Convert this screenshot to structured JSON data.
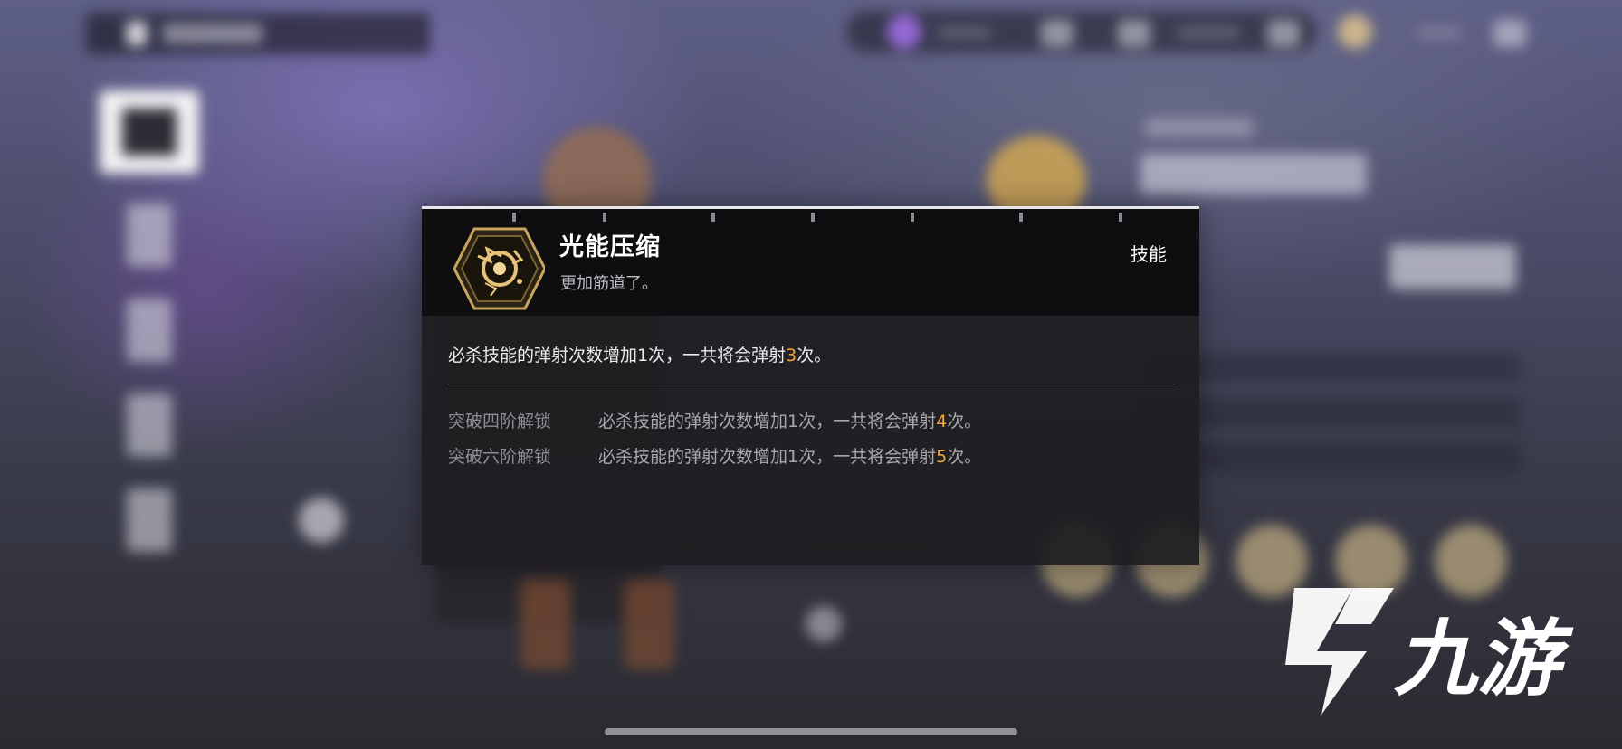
{
  "skill": {
    "name": "光能压缩",
    "subtitle": "更加筋道了。",
    "type_label": "技能",
    "description": {
      "prefix": "必杀技能的弹射次数增加1次，一共将会弹射",
      "highlight": "3",
      "suffix": "次。"
    },
    "unlocks": [
      {
        "label": "突破四阶解锁",
        "prefix": "必杀技能的弹射次数增加1次，一共将会弹射",
        "highlight": "4",
        "suffix": "次。"
      },
      {
        "label": "突破六阶解锁",
        "prefix": "必杀技能的弹射次数增加1次，一共将会弹射",
        "highlight": "5",
        "suffix": "次。"
      }
    ]
  },
  "icons": {
    "skill": "hexagon-skill-icon",
    "back": "back-arrow-icon"
  },
  "colors": {
    "highlight": "#f3a63a",
    "gold": "#c9a45c",
    "popup_bg": "#1e1e21",
    "header_bg": "#0e0e10"
  },
  "watermark": {
    "text": "九游"
  }
}
